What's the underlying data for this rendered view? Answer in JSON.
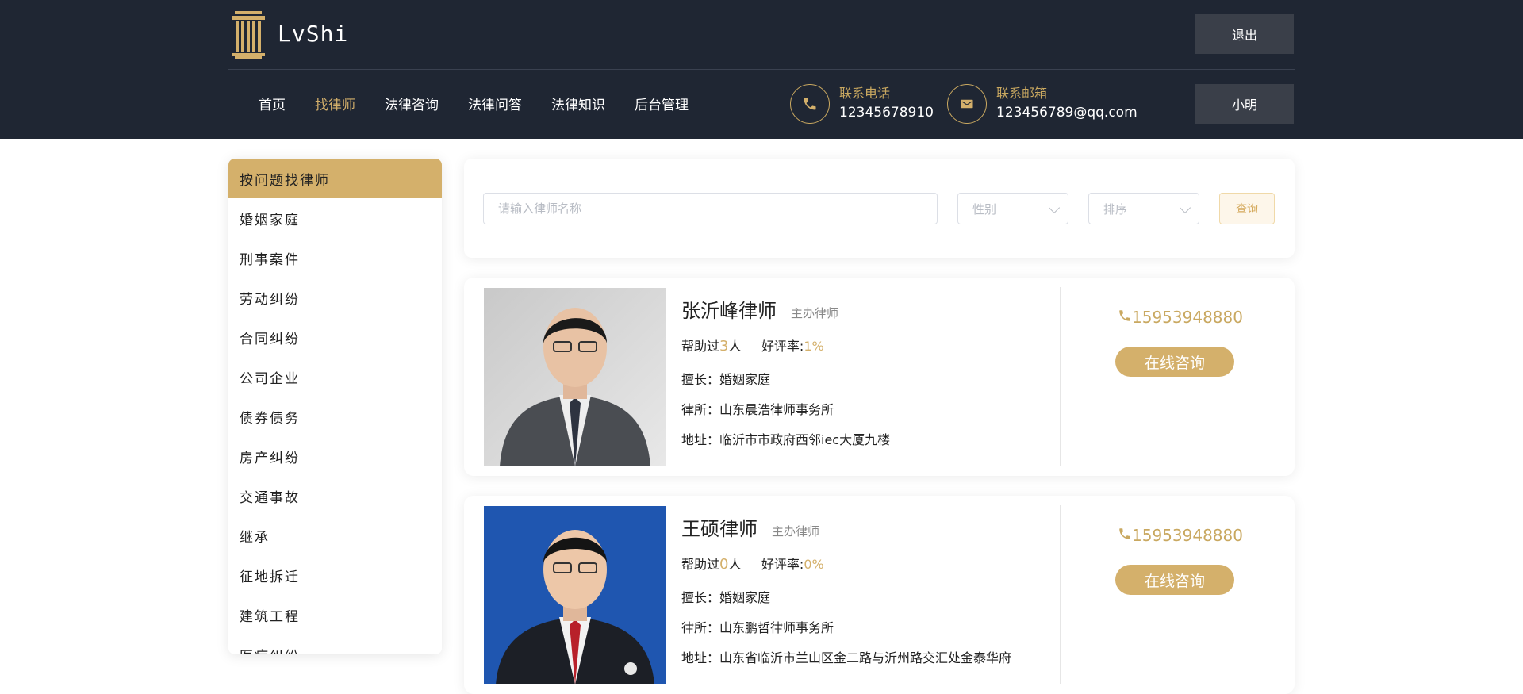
{
  "brand": {
    "name": "LvShi"
  },
  "header": {
    "logout_label": "退出",
    "user_label": "小明",
    "nav": [
      {
        "label": "首页",
        "active": false
      },
      {
        "label": "找律师",
        "active": true
      },
      {
        "label": "法律咨询",
        "active": false
      },
      {
        "label": "法律问答",
        "active": false
      },
      {
        "label": "法律知识",
        "active": false
      },
      {
        "label": "后台管理",
        "active": false
      }
    ],
    "contact_phone": {
      "label": "联系电话",
      "value": "12345678910",
      "icon": "phone-icon"
    },
    "contact_email": {
      "label": "联系邮箱",
      "value": "123456789@qq.com",
      "icon": "mail-icon"
    }
  },
  "sidebar": {
    "heading": "按问题找律师",
    "items": [
      "婚姻家庭",
      "刑事案件",
      "劳动纠纷",
      "合同纠纷",
      "公司企业",
      "债券债务",
      "房产纠纷",
      "交通事故",
      "继承",
      "征地拆迁",
      "建筑工程",
      "医疗纠纷"
    ]
  },
  "search": {
    "placeholder": "请输入律师名称",
    "gender_placeholder": "性别",
    "sort_placeholder": "排序",
    "query_label": "查询"
  },
  "lawyers": [
    {
      "name": "张沂峰律师",
      "title": "主办律师",
      "helped_prefix": "帮助过",
      "helped_count": "3",
      "helped_suffix": "人",
      "rating_label": "好评率:",
      "rating": "1%",
      "specialty": "擅长：婚姻家庭",
      "firm": "律所：山东晨浩律师事务所",
      "address": "地址：临沂市市政府西邻iec大厦九楼",
      "phone": "15953948880",
      "consult_label": "在线咨询"
    },
    {
      "name": "王硕律师",
      "title": "主办律师",
      "helped_prefix": "帮助过",
      "helped_count": "0",
      "helped_suffix": "人",
      "rating_label": "好评率:",
      "rating": "0%",
      "specialty": "擅长：婚姻家庭",
      "firm": "律所：山东鹏哲律师事务所",
      "address": "地址：山东省临沂市兰山区金二路与沂州路交汇处金泰华府",
      "phone": "15953948880",
      "consult_label": "在线咨询"
    }
  ],
  "colors": {
    "accent": "#d4b06b",
    "header_bg": "#1f2633"
  }
}
